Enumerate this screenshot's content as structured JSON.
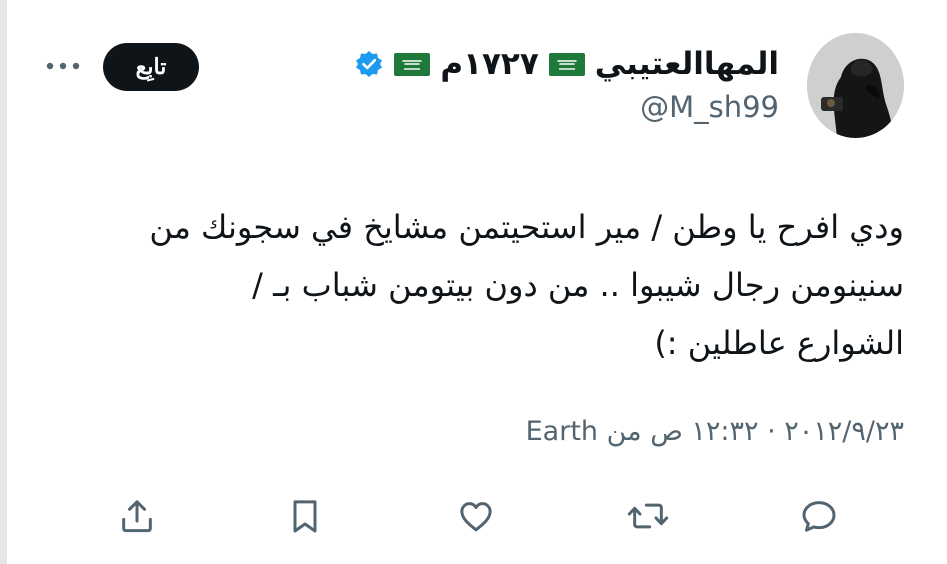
{
  "tweet": {
    "author": {
      "display_name": "المهاالعتيبي",
      "display_name_suffix": "١٧٢٧م",
      "handle": "@M_sh99",
      "verified": true,
      "avatar_icon": "profile-avatar"
    },
    "follow_label": "تابِع",
    "more_icon": "more-horizontal-icon",
    "text_lines": [
      "ودي افرح يا وطن / مير استحيتمن مشايخ في سجونك من",
      "سنينومن رجال شيبوا .. من دون بيتومن شباب بـ /",
      "الشوارع عاطلين :)"
    ],
    "meta": "٢٠١٢/٩/٢٣ · ١٢:٣٢ ص من Earth",
    "actions": {
      "reply_icon": "reply-icon",
      "retweet_icon": "retweet-icon",
      "like_icon": "like-icon",
      "bookmark_icon": "bookmark-icon",
      "share_icon": "share-icon"
    }
  },
  "colors": {
    "text_primary": "#0f1419",
    "text_secondary": "#536471",
    "verified_blue": "#1d9bf0",
    "flag_green": "#1f7a3a",
    "button_black": "#0f1419"
  }
}
